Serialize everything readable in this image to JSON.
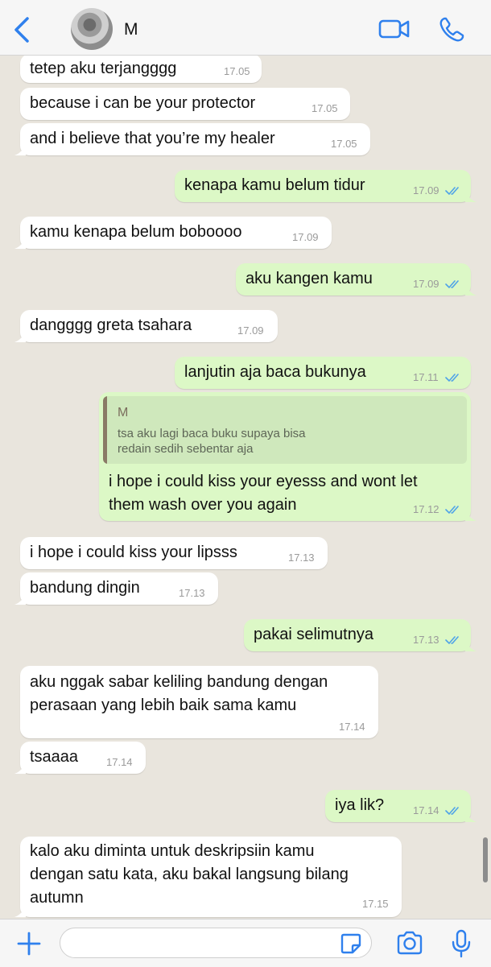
{
  "header": {
    "contact_name": "M",
    "back_icon": "chevron-left-icon",
    "video_icon": "video-camera-icon",
    "call_icon": "phone-icon"
  },
  "colors": {
    "accent": "#2f80ed",
    "outgoing_bubble": "#dcf8c6",
    "incoming_bubble": "#ffffff",
    "chat_background": "#e9e5dd",
    "read_ticks": "#4fa3e8"
  },
  "messages": [
    {
      "direction": "in",
      "text": "tetep aku terjangggg",
      "time": "17.05"
    },
    {
      "direction": "in",
      "text": "because i can be your protector",
      "time": "17.05"
    },
    {
      "direction": "in",
      "text": "and i believe that you’re my healer",
      "time": "17.05"
    },
    {
      "direction": "out",
      "text": "kenapa kamu belum tidur",
      "time": "17.09",
      "status": "read"
    },
    {
      "direction": "in",
      "text": "kamu kenapa belum boboooo",
      "time": "17.09"
    },
    {
      "direction": "out",
      "text": "aku kangen kamu",
      "time": "17.09",
      "status": "read"
    },
    {
      "direction": "in",
      "text": "dangggg greta tsahara",
      "time": "17.09"
    },
    {
      "direction": "out",
      "text": "lanjutin aja baca bukunya",
      "time": "17.11",
      "status": "read"
    },
    {
      "direction": "out",
      "reply": {
        "author": "M",
        "lines": [
          "tsa aku lagi baca buku supaya bisa",
          "redain sedih sebentar aja"
        ]
      },
      "lines": [
        "i hope i could kiss your eyesss and wont let",
        "them wash over you again"
      ],
      "time": "17.12",
      "status": "read"
    },
    {
      "direction": "in",
      "text": "i hope i could kiss your lipsss",
      "time": "17.13"
    },
    {
      "direction": "in",
      "text": "bandung dingin",
      "time": "17.13"
    },
    {
      "direction": "out",
      "text": "pakai selimutnya",
      "time": "17.13",
      "status": "read"
    },
    {
      "direction": "in",
      "lines": [
        "aku nggak sabar keliling bandung dengan",
        "perasaan yang lebih baik sama kamu"
      ],
      "time": "17.14"
    },
    {
      "direction": "in",
      "text": "tsaaaa",
      "time": "17.14"
    },
    {
      "direction": "out",
      "text": "iya lik?",
      "time": "17.14",
      "status": "read"
    },
    {
      "direction": "in",
      "lines": [
        "kalo aku diminta untuk deskripsiin kamu",
        "dengan satu kata, aku bakal langsung bilang",
        "autumn"
      ],
      "time": "17.15"
    }
  ],
  "composer": {
    "placeholder": "",
    "plus_icon": "plus-icon",
    "sticker_icon": "sticker-icon",
    "camera_icon": "camera-icon",
    "mic_icon": "microphone-icon"
  }
}
